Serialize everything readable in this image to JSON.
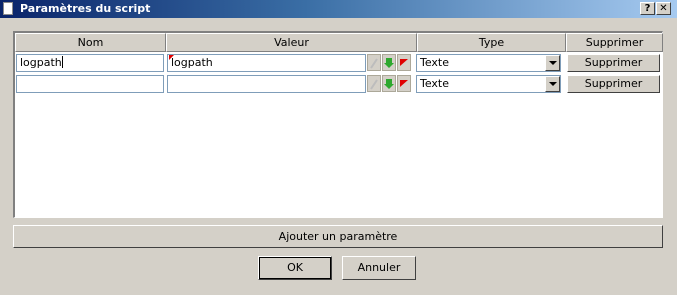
{
  "window": {
    "title": "Paramètres du script",
    "help_label": "?",
    "close_label": "✕"
  },
  "table": {
    "headers": {
      "name": "Nom",
      "value": "Valeur",
      "type": "Type",
      "delete": "Supprimer"
    },
    "rows": [
      {
        "name": "logpath",
        "value": "logpath",
        "type": "Texte",
        "delete_label": "Supprimer"
      },
      {
        "name": "",
        "value": "",
        "type": "Texte",
        "delete_label": "Supprimer"
      }
    ]
  },
  "add_parameter_label": "Ajouter un paramètre",
  "ok_label": "OK",
  "cancel_label": "Annuler",
  "colors": {
    "titlebar_start": "#0a246a",
    "titlebar_end": "#a6caf0",
    "face": "#d4d0c8",
    "marker_red": "#e00000",
    "arrow_green": "#2ea82e"
  }
}
